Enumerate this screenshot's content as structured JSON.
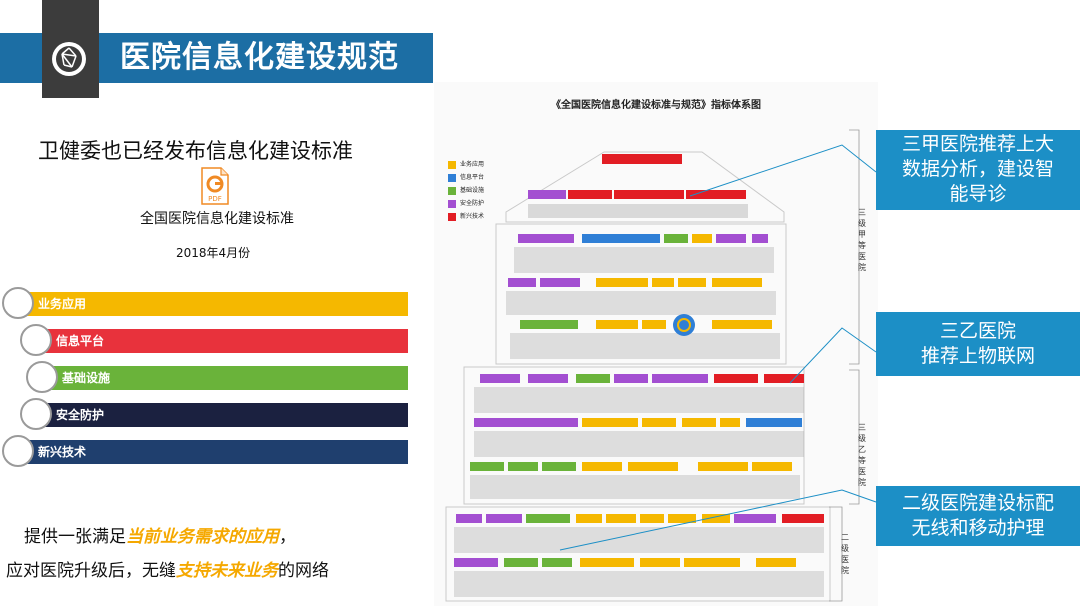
{
  "title": "医院信息化建设规范",
  "subtitle": "卫健委也已经发布信息化建设标准",
  "pdf_label": "PDF",
  "doc_name": "全国医院信息化建设标准",
  "doc_date": "2018年4月份",
  "categories": [
    {
      "label": "业务应用",
      "color": "#f5b800"
    },
    {
      "label": "信息平台",
      "color": "#e8323c"
    },
    {
      "label": "基础设施",
      "color": "#6ab33a"
    },
    {
      "label": "安全防护",
      "color": "#1b2140"
    },
    {
      "label": "新兴技术",
      "color": "#1f3f6e"
    }
  ],
  "bottom_line1": {
    "pre": "提供一张满足",
    "hl": "当前业务需求的应用",
    "post": "，"
  },
  "bottom_line2": {
    "pre": "应对医院升级后，无缝",
    "hl": "支持未来业务",
    "post": "的网络"
  },
  "diagram": {
    "title": "《全国医院信息化建设标准与规范》指标体系图",
    "legend": [
      {
        "label": "业务应用",
        "color": "#f5b800"
      },
      {
        "label": "信息平台",
        "color": "#2f7fd6"
      },
      {
        "label": "基础设施",
        "color": "#6ab33a"
      },
      {
        "label": "安全防护",
        "color": "#a34fd1"
      },
      {
        "label": "新兴技术",
        "color": "#e21d24"
      }
    ],
    "side_labels": [
      "三级甲等医院",
      "三级乙等医院",
      "二级医院"
    ]
  },
  "callouts": [
    {
      "line1": "三甲医院推荐上大",
      "line2": "数据分析，建设智",
      "line3": "能导诊"
    },
    {
      "line1": "三乙医院",
      "line2": "推荐上物联网"
    },
    {
      "line1": "二级医院建设标配",
      "line2": "无线和移动护理"
    }
  ],
  "colors": {
    "banner": "#1c6ea4",
    "callout": "#1c8fc6",
    "highlight": "#f5a800"
  }
}
